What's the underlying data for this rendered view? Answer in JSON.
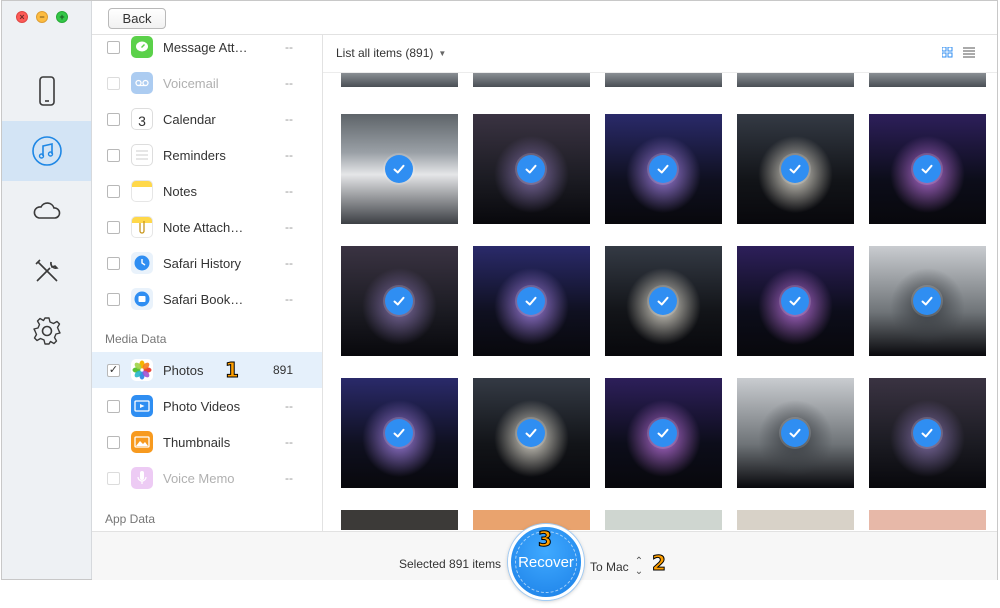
{
  "window": {
    "controls": {
      "close": "×",
      "minimize": "−",
      "zoom": "+"
    }
  },
  "toolbar": {
    "back_label": "Back"
  },
  "rail": {
    "items": [
      {
        "icon": "phone-icon",
        "active": false
      },
      {
        "icon": "music-note-icon",
        "active": true
      },
      {
        "icon": "cloud-icon",
        "active": false
      },
      {
        "icon": "tools-icon",
        "active": false
      },
      {
        "icon": "gear-icon",
        "active": false
      }
    ],
    "accent": "#1e87e5"
  },
  "categories": {
    "items": [
      {
        "label": "Message Att…",
        "count": "--",
        "icon": "message-attachments-icon",
        "checked": false,
        "disabled": false
      },
      {
        "label": "Voicemail",
        "count": "--",
        "icon": "voicemail-icon",
        "checked": false,
        "disabled": true
      },
      {
        "label": "Calendar",
        "count": "--",
        "icon": "calendar-icon",
        "checked": false,
        "disabled": false,
        "icon_text": "3"
      },
      {
        "label": "Reminders",
        "count": "--",
        "icon": "reminders-icon",
        "checked": false,
        "disabled": false
      },
      {
        "label": "Notes",
        "count": "--",
        "icon": "notes-icon",
        "checked": false,
        "disabled": false
      },
      {
        "label": "Note Attach…",
        "count": "--",
        "icon": "note-attachments-icon",
        "checked": false,
        "disabled": false
      },
      {
        "label": "Safari History",
        "count": "--",
        "icon": "safari-history-icon",
        "checked": false,
        "disabled": false
      },
      {
        "label": "Safari Book…",
        "count": "--",
        "icon": "safari-bookmarks-icon",
        "checked": false,
        "disabled": false
      }
    ],
    "media_title": "Media Data",
    "media_items": [
      {
        "label": "Photos",
        "count": "891",
        "icon": "photos-icon",
        "checked": true,
        "disabled": false,
        "selected": true
      },
      {
        "label": "Photo Videos",
        "count": "--",
        "icon": "photo-videos-icon",
        "checked": false,
        "disabled": false
      },
      {
        "label": "Thumbnails",
        "count": "--",
        "icon": "thumbnails-icon",
        "checked": false,
        "disabled": false
      },
      {
        "label": "Voice Memo",
        "count": "--",
        "icon": "voice-memo-icon",
        "checked": false,
        "disabled": true
      }
    ],
    "app_title": "App Data",
    "check_mark": "✓"
  },
  "content": {
    "list_label": "List all items (891)",
    "view_modes": [
      "grid-view-icon",
      "list-view-icon"
    ],
    "thumb_rows": 4,
    "thumb_cols": 5
  },
  "footer": {
    "selected_text": "Selected 891 items",
    "recover_label": "Recover",
    "destination": "To Mac"
  },
  "annotations": {
    "step1": "1",
    "step2": "2",
    "step3": "3"
  }
}
